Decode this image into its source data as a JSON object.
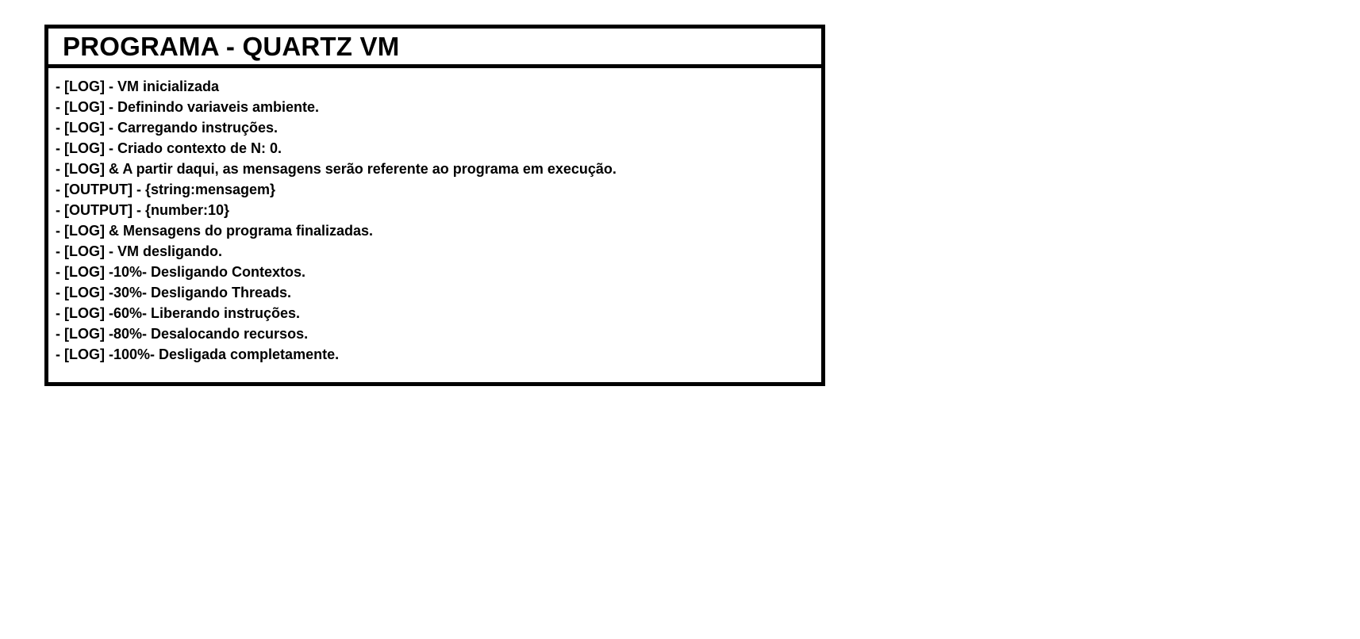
{
  "window": {
    "title": "PROGRAMA - QUARTZ VM"
  },
  "log": {
    "lines": [
      "- [LOG] - VM inicializada",
      "- [LOG] - Definindo variaveis ambiente.",
      "- [LOG] - Carregando instruções.",
      "- [LOG] - Criado contexto de N: 0.",
      "- [LOG] & A partir daqui, as mensagens serão referente ao programa em execução.",
      "- [OUTPUT] - {string:mensagem}",
      "- [OUTPUT] - {number:10}",
      "- [LOG] & Mensagens do programa finalizadas.",
      "- [LOG] - VM desligando.",
      "- [LOG] -10%- Desligando Contextos.",
      "- [LOG] -30%- Desligando Threads.",
      "- [LOG] -60%- Liberando instruções.",
      "- [LOG] -80%- Desalocando recursos.",
      "- [LOG] -100%- Desligada completamente."
    ]
  },
  "colors": {
    "border": "#000000",
    "background": "#ffffff",
    "text": "#000000"
  }
}
